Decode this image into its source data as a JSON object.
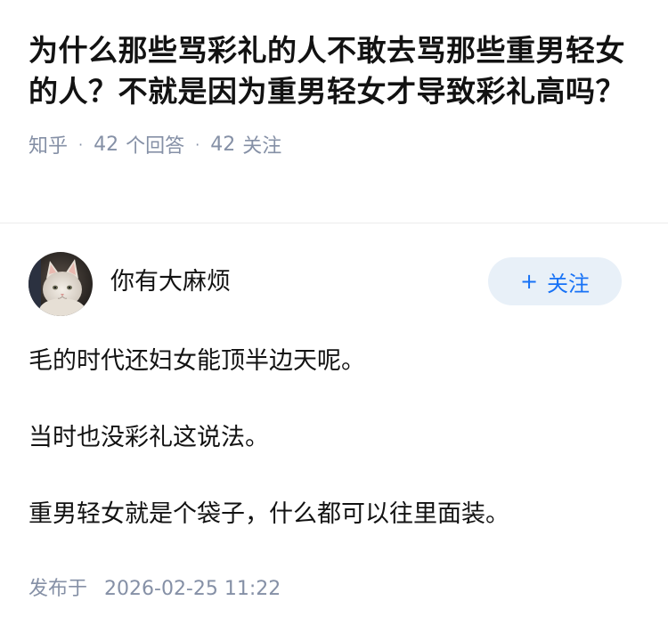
{
  "question": {
    "title": "为什么那些骂彩礼的人不敢去骂那些重男轻女的人？不就是因为重男轻女才导致彩礼高吗？",
    "source": "知乎",
    "separator": "·",
    "answers_count": "42",
    "answers_label": "个回答",
    "follows_count": "42",
    "follows_label": "关注"
  },
  "answer": {
    "author_name": "你有大麻烦",
    "follow_button": {
      "icon": "+",
      "label": "关注"
    },
    "paragraphs": [
      "毛的时代还妇女能顶半边天呢。",
      "当时也没彩礼这说法。",
      "重男轻女就是个袋子，什么都可以往里面装。"
    ],
    "published_label": "发布于",
    "published_time": "2026-02-25 11:22"
  },
  "icons": {
    "avatar": "white-cat-avatar"
  }
}
